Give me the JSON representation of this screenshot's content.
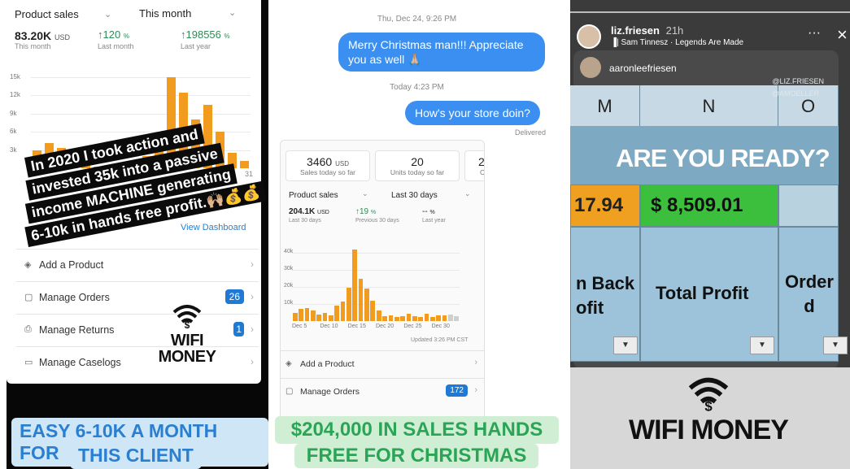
{
  "panel1": {
    "dropdown1": "Product sales",
    "dropdown2": "This month",
    "kpi1": {
      "value": "83.20K",
      "unit": "USD",
      "label": "This month"
    },
    "kpi2": {
      "value": "120",
      "unit": "%",
      "label": "Last month"
    },
    "kpi3": {
      "value": "198556",
      "unit": "%",
      "label": "Last year"
    },
    "y_ticks": [
      "15k",
      "12k",
      "9k",
      "6k",
      "3k"
    ],
    "x_tick_fragment": "31",
    "view_dashboard": "View Dashboard",
    "promo_lines": [
      "In 2020 I took action and",
      "invested 35k into a passive",
      "income MACHINE generating",
      "6-10k in hands free profit.🙌🏼💰💰"
    ],
    "menu": [
      {
        "label": "Add a Product",
        "icon": "product-icon"
      },
      {
        "label": "Manage Orders",
        "icon": "orders-icon",
        "badge": "26"
      },
      {
        "label": "Manage Returns",
        "icon": "returns-icon",
        "badge": "1"
      },
      {
        "label": "Manage Caselogs",
        "icon": "caselogs-icon"
      }
    ],
    "logo_text": "WIFI MONEY",
    "caption_line1": "EASY 6-10K A MONTH FOR",
    "caption_line2": "THIS CLIENT"
  },
  "panel2": {
    "timestamp1": "Thu, Dec 24, 9:26 PM",
    "message1": "Merry Christmas man!!! Appreciate you as well 🙏🏼",
    "timestamp2": "Today 4:23 PM",
    "message2": "How's your store doin?",
    "delivered": "Delivered",
    "shot": {
      "box1": {
        "value": "3460",
        "unit": "USD",
        "label": "Sales today so far"
      },
      "box2": {
        "value": "20",
        "label": "Units today so far"
      },
      "box3_fragment": "2",
      "box3_label_fragment": "C",
      "dropdown1": "Product sales",
      "dropdown2": "Last 30 days",
      "kpi1": {
        "value": "204.1K",
        "unit": "USD",
        "label": "Last 30 days"
      },
      "kpi2": {
        "value": "19",
        "unit": "%",
        "label": "Previous 30 days"
      },
      "kpi3": {
        "value": "--",
        "unit": "%",
        "label": "Last year"
      },
      "y_ticks": [
        "40k",
        "30k",
        "20k",
        "10k"
      ],
      "x_ticks": [
        "Dec 5",
        "Dec 10",
        "Dec 15",
        "Dec 20",
        "Dec 25",
        "Dec 30"
      ],
      "updated": "Updated 3:26 PM CST",
      "menu": [
        {
          "label": "Add a Product",
          "icon": "product-icon"
        },
        {
          "label": "Manage Orders",
          "icon": "orders-icon",
          "badge": "172"
        }
      ]
    },
    "caption_line1": "$204,000 IN SALES HANDS",
    "caption_line2": "FREE FOR CHRISTMAS"
  },
  "panel3": {
    "username": "liz.friesen",
    "time": "21h",
    "music": "Sam Tinnesz · Legends Are Made",
    "reshare_user": "aaronleefriesen",
    "tag1": "@LIZ.FRIESEN",
    "tag2": "@AMOELLER",
    "col_m": "M",
    "col_n": "N",
    "col_o": "O",
    "headline": "ARE YOU READY?",
    "cell_left": "17.94",
    "cell_mid": "$  8,509.01",
    "hdr_left_1": "n Back",
    "hdr_left_2": "ofit",
    "hdr_mid": "Total Profit",
    "hdr_right_1": "Order",
    "hdr_right_2": "d",
    "logo_text": "WIFI MONEY",
    "more": "···",
    "close": "×"
  },
  "colors": {
    "bar_orange": "#f29c1f",
    "imessage_blue": "#3a8ff0",
    "cell_orange": "#f0a020",
    "cell_green": "#3cbf3c",
    "caption1_text": "#2a7fd0",
    "caption2_text": "#2aa455"
  },
  "chart_data": [
    {
      "type": "bar",
      "ylim": [
        0,
        15000
      ],
      "values": [
        3000,
        4200,
        3300,
        1000,
        800,
        300,
        400,
        800,
        1200,
        2000,
        4000,
        15000,
        12500,
        8000,
        10500,
        6000,
        2500,
        1200
      ]
    },
    {
      "type": "bar",
      "ylim": [
        0,
        45000
      ],
      "values": [
        5000,
        7000,
        7500,
        6000,
        4000,
        5000,
        3500,
        9000,
        11500,
        19500,
        42000,
        25000,
        19000,
        12000,
        6000,
        3000,
        3500,
        2500,
        3000,
        4500,
        3000,
        2500,
        4500,
        2500,
        3500,
        3500,
        4000,
        3000
      ]
    }
  ]
}
